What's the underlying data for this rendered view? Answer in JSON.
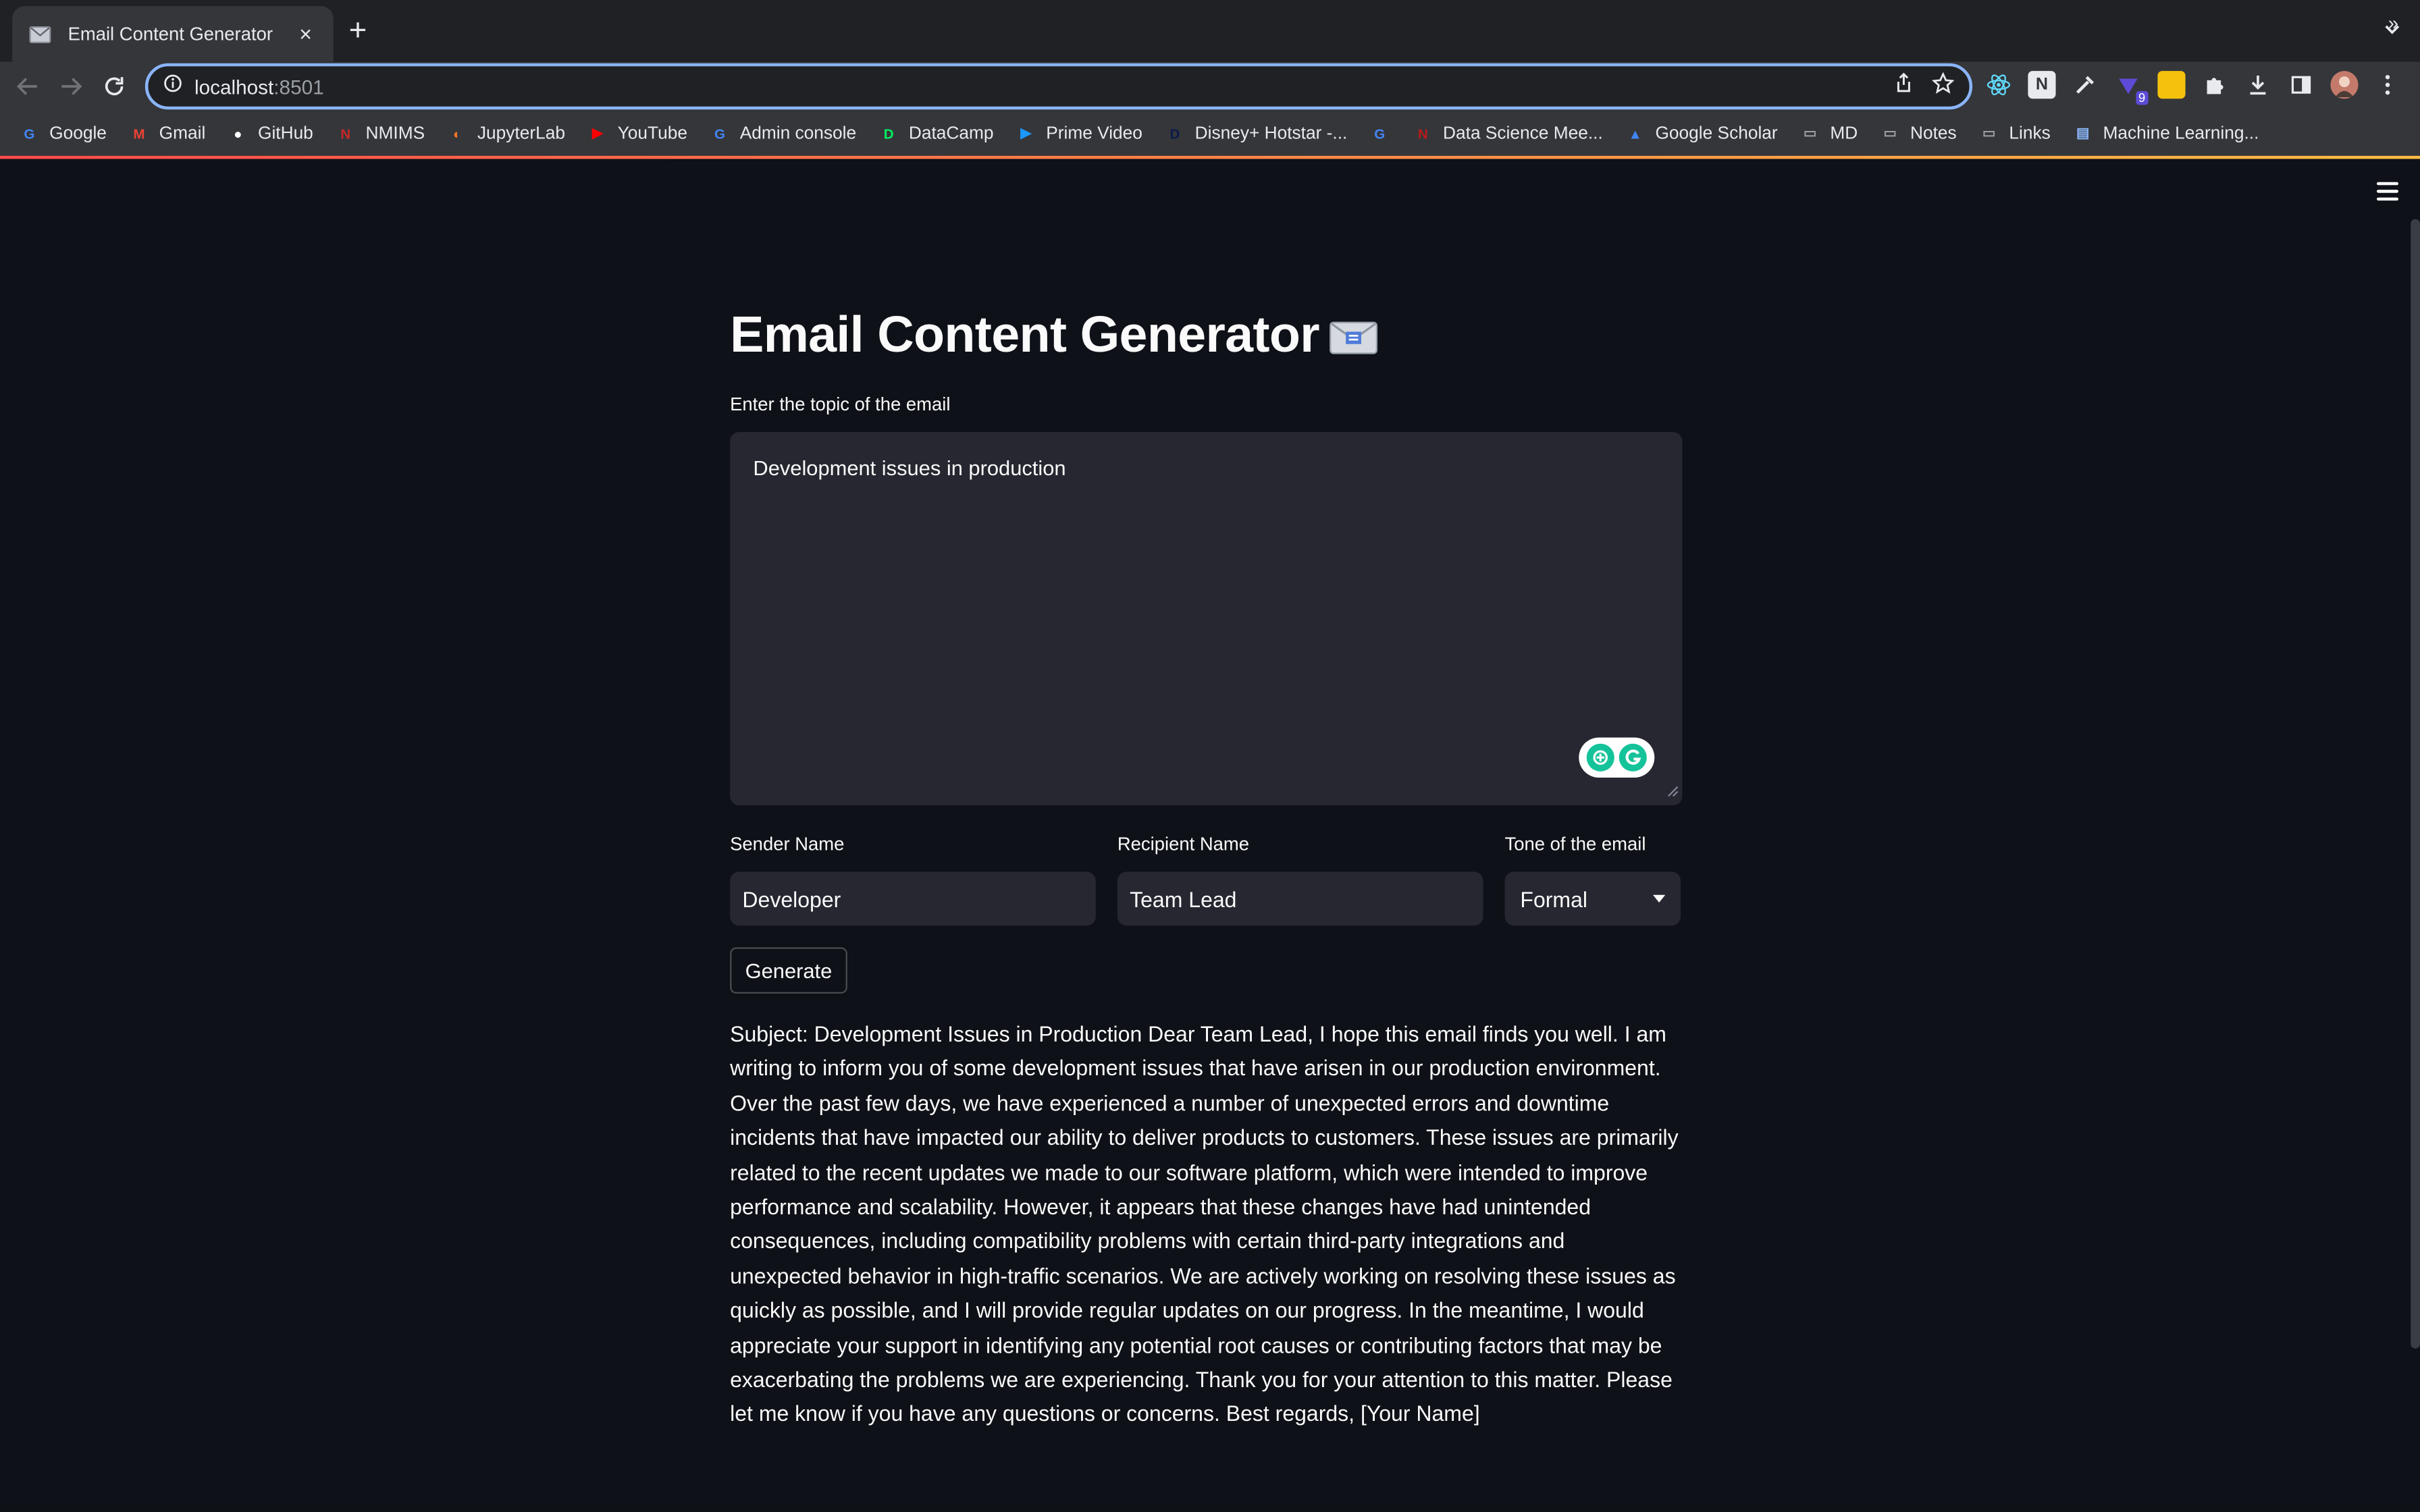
{
  "browser": {
    "tab_title": "Email Content Generator",
    "tab_close": "×",
    "new_tab": "+",
    "url_host": "localhost",
    "url_port": ":8501",
    "extension_badge": "9"
  },
  "bookmarks": [
    {
      "label": "Google",
      "icon": "google-icon",
      "color": "#4285f4",
      "glyph": "G"
    },
    {
      "label": "Gmail",
      "icon": "gmail-icon",
      "color": "#ea4335",
      "glyph": "M"
    },
    {
      "label": "GitHub",
      "icon": "github-icon",
      "color": "#ffffff",
      "glyph": "●"
    },
    {
      "label": "NMIMS",
      "icon": "nmims-icon",
      "color": "#c62828",
      "glyph": "N"
    },
    {
      "label": "JupyterLab",
      "icon": "jupyter-icon",
      "color": "#f37626",
      "glyph": "◐"
    },
    {
      "label": "YouTube",
      "icon": "youtube-icon",
      "color": "#ff0000",
      "glyph": "▶"
    },
    {
      "label": "Admin console",
      "icon": "google-icon",
      "color": "#4285f4",
      "glyph": "G"
    },
    {
      "label": "DataCamp",
      "icon": "datacamp-icon",
      "color": "#03ef62",
      "glyph": "D"
    },
    {
      "label": "Prime Video",
      "icon": "prime-video-icon",
      "color": "#1a98ff",
      "glyph": "▶"
    },
    {
      "label": "Disney+ Hotstar -...",
      "icon": "hotstar-icon",
      "color": "#0c1a4b",
      "glyph": "D"
    },
    {
      "label": "",
      "icon": "google-icon",
      "color": "#4285f4",
      "glyph": "G"
    },
    {
      "label": "Data Science Mee...",
      "icon": "data-science-icon",
      "color": "#b71c1c",
      "glyph": "N"
    },
    {
      "label": "Google Scholar",
      "icon": "scholar-icon",
      "color": "#4285f4",
      "glyph": "▲"
    },
    {
      "label": "MD",
      "icon": "folder-icon",
      "color": "#9aa0a6",
      "glyph": "▭"
    },
    {
      "label": "Notes",
      "icon": "folder-icon",
      "color": "#9aa0a6",
      "glyph": "▭"
    },
    {
      "label": "Links",
      "icon": "folder-icon",
      "color": "#9aa0a6",
      "glyph": "▭"
    },
    {
      "label": "Machine Learning...",
      "icon": "ml-icon",
      "color": "#8ab4f8",
      "glyph": "▤"
    }
  ],
  "bookmarks_more": "»",
  "app": {
    "title": "Email Content Generator",
    "topic_label": "Enter the topic of the email",
    "topic_value": "Development issues in production",
    "sender_label": "Sender Name",
    "sender_value": "Developer",
    "recipient_label": "Recipient Name",
    "recipient_value": "Team Lead",
    "tone_label": "Tone of the email",
    "tone_value": "Formal",
    "generate_label": "Generate",
    "output": "Subject: Development Issues in Production Dear Team Lead, I hope this email finds you well. I am writing to inform you of some development issues that have arisen in our production environment. Over the past few days, we have experienced a number of unexpected errors and downtime incidents that have impacted our ability to deliver products to customers. These issues are primarily related to the recent updates we made to our software platform, which were intended to improve performance and scalability. However, it appears that these changes have had unintended consequences, including compatibility problems with certain third-party integrations and unexpected behavior in high-traffic scenarios. We are actively working on resolving these issues as quickly as possible, and I will provide regular updates on our progress. In the meantime, I would appreciate your support in identifying any potential root causes or contributing factors that may be exacerbating the problems we are experiencing. Thank you for your attention to this matter. Please let me know if you have any questions or concerns. Best regards, [Your Name]"
  },
  "colors": {
    "background": "#0e1117",
    "input_bg": "#262730",
    "accent": "#8ab4f8",
    "grammarly": "#15c39a"
  }
}
